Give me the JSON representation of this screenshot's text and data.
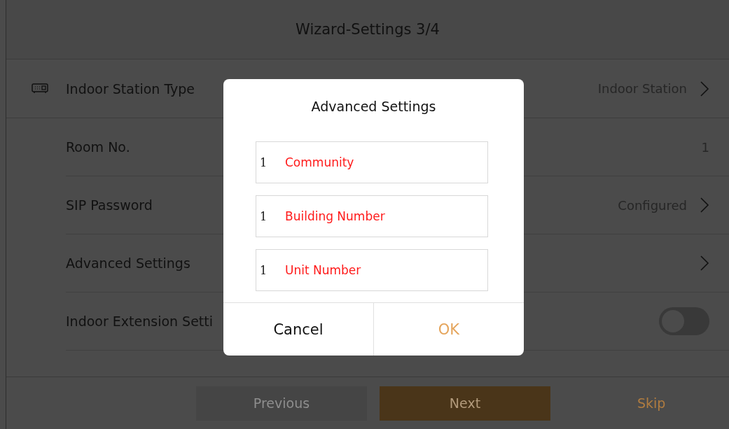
{
  "header": {
    "title": "Wizard-Settings 3/4"
  },
  "rows": [
    {
      "label": "Indoor Station Type",
      "kind": "link",
      "value": "Indoor Station",
      "icon": true
    },
    {
      "label": "Room No.",
      "kind": "text",
      "value": "1",
      "icon": false
    },
    {
      "label": "SIP Password",
      "kind": "link",
      "value": "Configured",
      "icon": false
    },
    {
      "label": "Advanced Settings",
      "kind": "link",
      "icon": false
    },
    {
      "label": "Indoor Extension Setti",
      "kind": "toggle",
      "on": false,
      "icon": false
    }
  ],
  "footer": {
    "previous": "Previous",
    "next": "Next",
    "skip": "Skip"
  },
  "dialog": {
    "title": "Advanced Settings",
    "fields": [
      {
        "value": "1",
        "label": "Community"
      },
      {
        "value": "1",
        "label": "Building Number"
      },
      {
        "value": "1",
        "label": "Unit Number"
      }
    ],
    "cancel": "Cancel",
    "ok": "OK"
  }
}
